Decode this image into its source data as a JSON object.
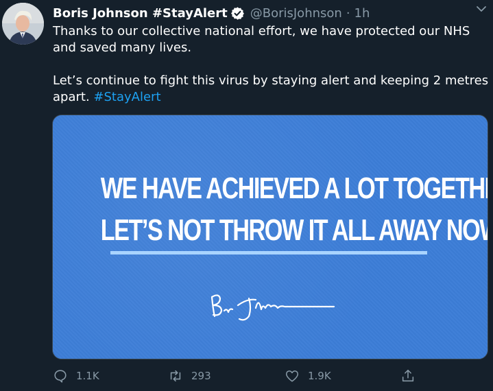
{
  "tweet": {
    "name": "Boris Johnson #StayAlert",
    "handle": "@BorisJohnson",
    "dot": "·",
    "time": "1h",
    "text_line1": "Thanks to our collective national effort, we have protected our NHS and saved many lives.",
    "text_line2": "Let’s continue to fight this virus by staying alert and keeping 2 metres apart.",
    "hashtag": "#StayAlert"
  },
  "media": {
    "line1": "WE HAVE ACHIEVED A LOT TOGETHER SO FAR",
    "line2": "LET’S NOT THROW IT ALL AWAY NOW",
    "background_color": "#3c7dd7",
    "underline_color": "#a9d4ff"
  },
  "actions": {
    "reply_count": "1.1K",
    "retweet_count": "293",
    "like_count": "1.9K",
    "share_icon": "share-icon"
  },
  "colors": {
    "background": "#15202b",
    "secondary_text": "#8899a6",
    "link": "#1da1f2",
    "verified": "#ffffff"
  }
}
